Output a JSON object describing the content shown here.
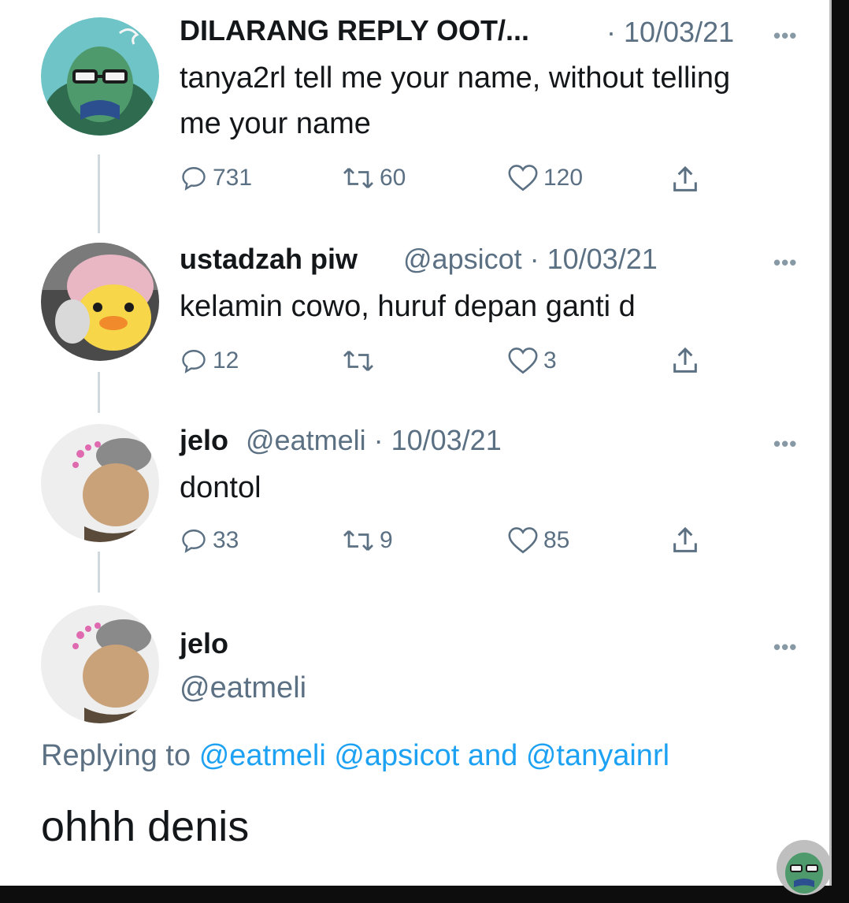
{
  "tweets": [
    {
      "name": "DILARANG REPLY OOT/...",
      "handle": "",
      "meta": "· 10/03/21",
      "text": "tanya2rl tell me your name, without telling me your name",
      "replies": "731",
      "retweets": "60",
      "likes": "120",
      "avatar_icon": "fish-avatar-icon"
    },
    {
      "name": "ustadzah piw",
      "meta": "@apsicot · 10/03/21",
      "text": "kelamin cowo, huruf depan ganti d",
      "replies": "12",
      "retweets": "",
      "likes": "3",
      "avatar_icon": "duck-avatar-icon"
    },
    {
      "name": "jelo",
      "meta": "@eatmeli · 10/03/21",
      "text": "dontol",
      "replies": "33",
      "retweets": "9",
      "likes": "85",
      "avatar_icon": "person-avatar-icon"
    }
  ],
  "main_tweet": {
    "name": "jelo",
    "handle": "@eatmeli",
    "replying_prefix": "Replying to",
    "replying_handles": "@eatmeli @apsicot",
    "replying_and": "and",
    "replying_last": "@tanyainrl",
    "text": "ohhh denis"
  },
  "more_label": "•••",
  "colors": {
    "accent": "#1da1f2",
    "secondary_text": "#5b7083",
    "thread_line": "#cfd9de"
  }
}
